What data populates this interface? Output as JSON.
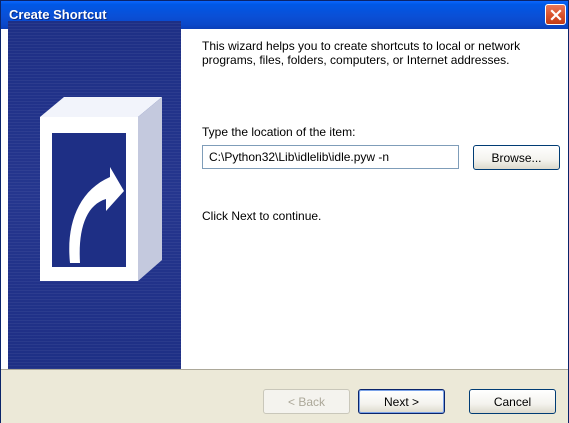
{
  "window": {
    "title": "Create Shortcut"
  },
  "icons": {
    "close": "close-icon",
    "shortcut": "shortcut-arrow-icon"
  },
  "colors": {
    "titlebar": "#0a4fd6",
    "side_panel": "#25368e",
    "close_button": "#d9522b"
  },
  "main": {
    "intro": "This wizard helps you to create shortcuts to local or network programs, files, folders, computers, or Internet addresses.",
    "location_label": "Type the location of the item:",
    "location_value": "C:\\Python32\\Lib\\idlelib\\idle.pyw -n",
    "browse_label": "Browse...",
    "continue_text": "Click Next to continue."
  },
  "footer": {
    "back_label": "< Back",
    "next_label": "Next >",
    "cancel_label": "Cancel"
  }
}
